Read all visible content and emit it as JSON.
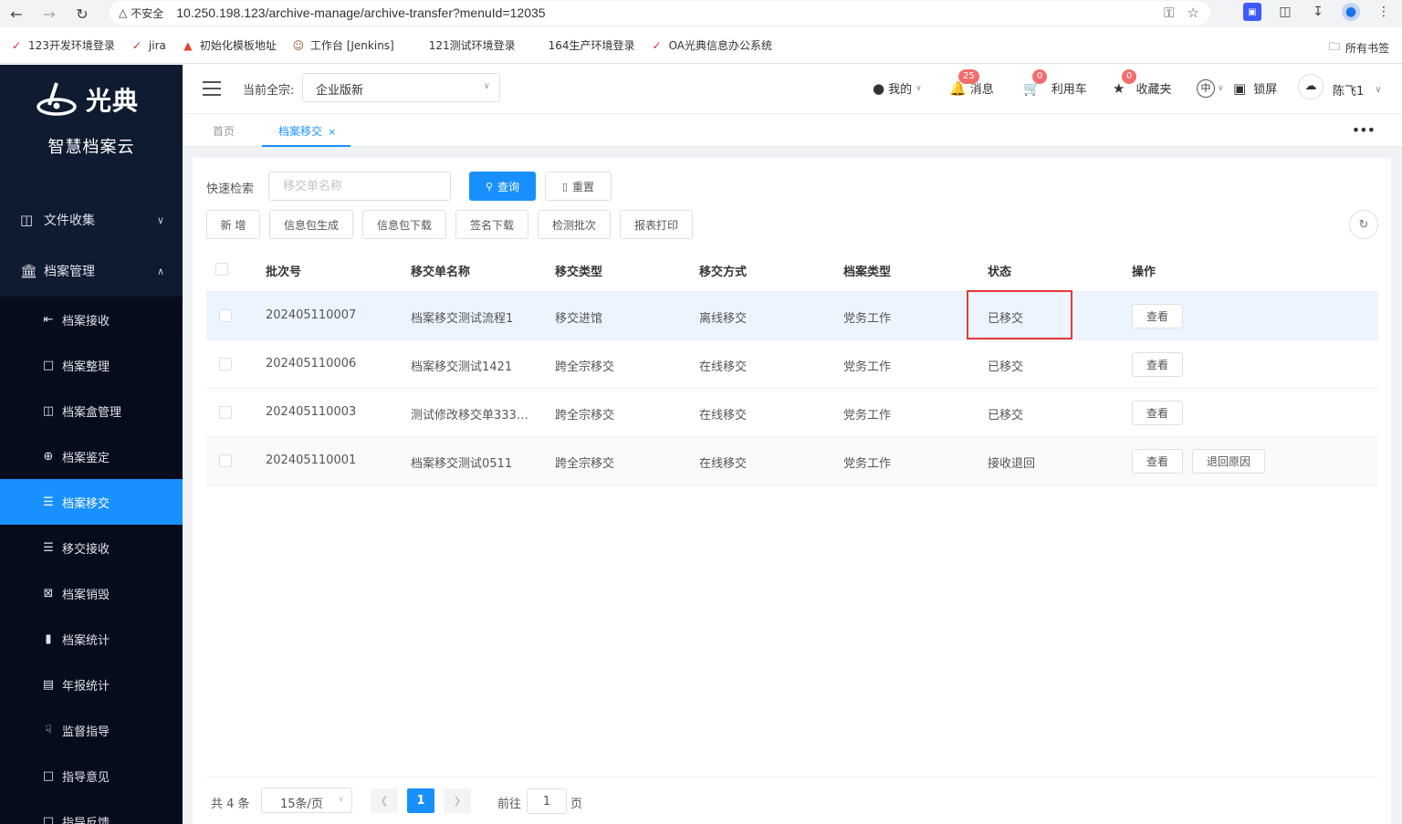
{
  "browser": {
    "insecure_label": "不安全",
    "url": "10.250.198.123/archive-manage/archive-transfer?menuId=12035",
    "bookmarks": [
      {
        "label": "123开发环境登录",
        "icon": "red-logo-icon"
      },
      {
        "label": "jira",
        "icon": "red-logo-icon"
      },
      {
        "label": "初始化模板地址",
        "icon": "gitlab-icon"
      },
      {
        "label": "工作台 [Jenkins]",
        "icon": "jenkins-icon"
      },
      {
        "label": "121测试环境登录",
        "icon": ""
      },
      {
        "label": "164生产环境登录",
        "icon": ""
      },
      {
        "label": "OA光典信息办公系统",
        "icon": "red-logo-icon"
      }
    ],
    "all_bookmarks": "所有书签"
  },
  "sidebar": {
    "logo_text": "光典",
    "subtitle": "智慧档案云",
    "groups": [
      {
        "label": "文件收集",
        "expanded": false
      },
      {
        "label": "档案管理",
        "expanded": true
      }
    ],
    "items": [
      {
        "label": "档案接收",
        "icon": "receive-icon",
        "active": false
      },
      {
        "label": "档案整理",
        "icon": "folder-icon",
        "active": false
      },
      {
        "label": "档案盒管理",
        "icon": "box-icon",
        "active": false
      },
      {
        "label": "档案鉴定",
        "icon": "target-icon",
        "active": false
      },
      {
        "label": "档案移交",
        "icon": "list-icon",
        "active": true
      },
      {
        "label": "移交接收",
        "icon": "list-icon",
        "active": false
      },
      {
        "label": "档案销毁",
        "icon": "destroy-icon",
        "active": false
      },
      {
        "label": "档案统计",
        "icon": "bar-chart-icon",
        "active": false
      },
      {
        "label": "年报统计",
        "icon": "report-icon",
        "active": false
      },
      {
        "label": "监督指导",
        "icon": "hand-icon",
        "active": false
      },
      {
        "label": "指导意见",
        "icon": "comment-icon",
        "active": false
      },
      {
        "label": "指导反馈",
        "icon": "feedback-icon",
        "active": false
      }
    ]
  },
  "header": {
    "current_label": "当前全宗:",
    "current_value": "企业版新",
    "mine": "我的",
    "messages": "消息",
    "messages_count": "25",
    "cart": "利用车",
    "cart_count": "0",
    "favorites": "收藏夹",
    "favorites_count": "0",
    "lang": "中",
    "lock": "锁屏",
    "user": "陈飞1"
  },
  "tabs": [
    {
      "label": "首页",
      "active": false
    },
    {
      "label": "档案移交",
      "active": true
    }
  ],
  "toolbar": {
    "quick_search_label": "快速检索",
    "search_placeholder": "移交单名称",
    "query": "查询",
    "reset": "重置",
    "actions": [
      "新 增",
      "信息包生成",
      "信息包下载",
      "签名下载",
      "检测批次",
      "报表打印"
    ]
  },
  "table": {
    "columns": [
      "批次号",
      "移交单名称",
      "移交类型",
      "移交方式",
      "档案类型",
      "状态",
      "操作"
    ],
    "rows": [
      {
        "batch": "202405110007",
        "name": "档案移交测试流程1",
        "type": "移交进馆",
        "mode": "离线移交",
        "archive_type": "党务工作",
        "status": "已移交",
        "ops": [
          "查看"
        ]
      },
      {
        "batch": "202405110006",
        "name": "档案移交测试1421",
        "type": "跨全宗移交",
        "mode": "在线移交",
        "archive_type": "党务工作",
        "status": "已移交",
        "ops": [
          "查看"
        ]
      },
      {
        "batch": "202405110003",
        "name": "测试修改移交单333…",
        "type": "跨全宗移交",
        "mode": "在线移交",
        "archive_type": "党务工作",
        "status": "已移交",
        "ops": [
          "查看"
        ]
      },
      {
        "batch": "202405110001",
        "name": "档案移交测试0511",
        "type": "跨全宗移交",
        "mode": "在线移交",
        "archive_type": "党务工作",
        "status": "接收退回",
        "ops": [
          "查看",
          "退回原因"
        ]
      }
    ]
  },
  "pagination": {
    "total": "共 4 条",
    "page_size": "15条/页",
    "current_page": "1",
    "goto_label": "前往",
    "goto_value": "1",
    "page_unit": "页"
  },
  "colors": {
    "primary": "#1890ff",
    "sidebar_bg": "#0e1b31",
    "highlight_box": "#e53935"
  }
}
